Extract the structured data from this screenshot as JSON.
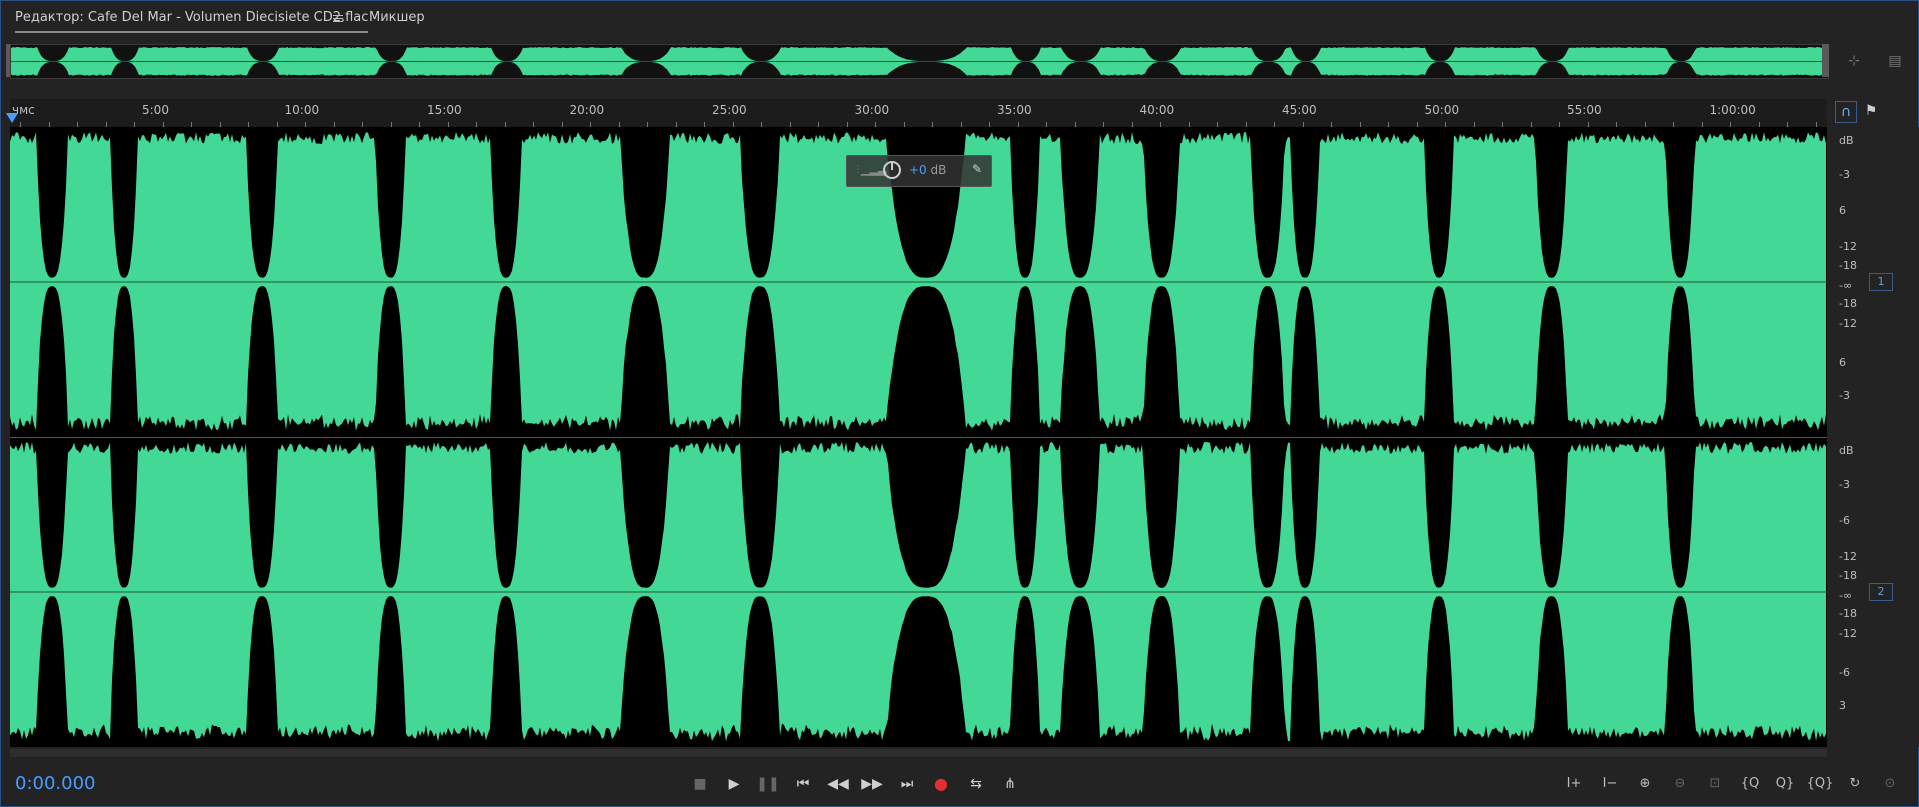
{
  "tabs": {
    "editor": "Редактор: Cafe Del Mar - Volumen Diecisiete CD2.flac",
    "mixer": "Микшер"
  },
  "ruler": {
    "unit": "чмс",
    "ticks": [
      "5:00",
      "10:00",
      "15:00",
      "20:00",
      "25:00",
      "30:00",
      "35:00",
      "40:00",
      "45:00",
      "50:00",
      "55:00",
      "1:00:00"
    ]
  },
  "hud": {
    "value": "+0",
    "unit": "dB"
  },
  "db_scale": {
    "channel1": [
      "dB",
      "-3",
      "6",
      "-12",
      "-18",
      "-∞",
      "-18",
      "-12",
      "6",
      "-3"
    ],
    "channel2": [
      "dB",
      "-3",
      "-6",
      "-12",
      "-18",
      "-∞",
      "-18",
      "-12",
      "-6",
      "3"
    ],
    "badges": [
      "1",
      "2"
    ]
  },
  "transport": {
    "time": "0:00.000"
  },
  "colors": {
    "waveform": "#44d896",
    "accent": "#4a9cff",
    "record": "#e03030"
  },
  "icons": {
    "tab_menu": "menu-icon",
    "zoom_area": "zoom-area-icon",
    "panel": "panel-icon",
    "headphones": "headphones-icon",
    "marker": "marker-icon"
  }
}
